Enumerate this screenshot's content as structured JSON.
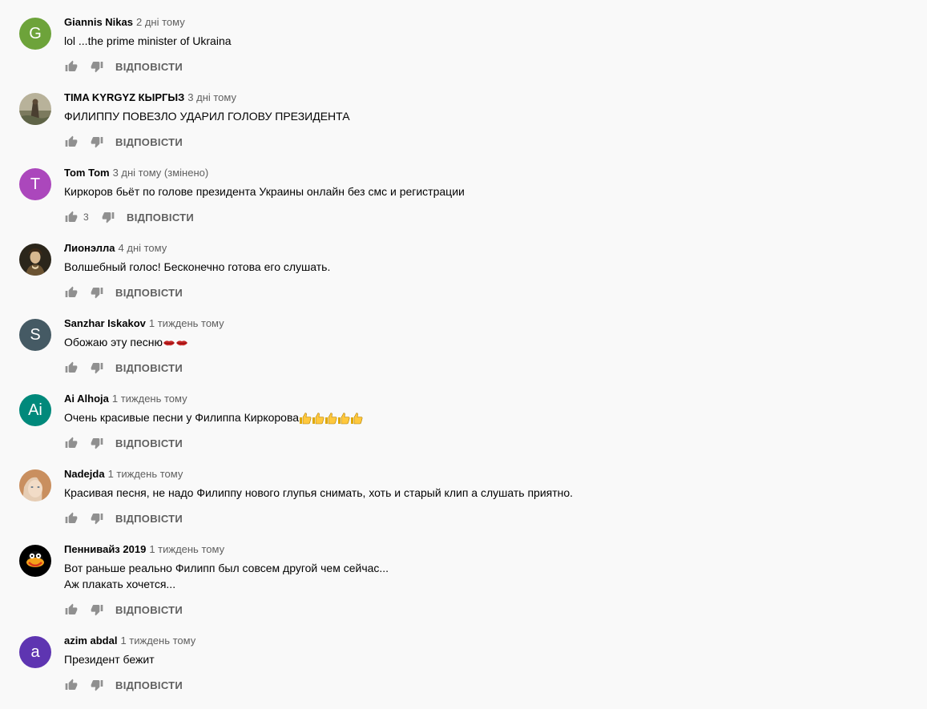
{
  "reply_label": "ВІДПОВІСТИ",
  "comments": [
    {
      "author": "Giannis Nikas",
      "time": "2 дні тому",
      "text": "lol ...the prime minister of Ukraina",
      "avatar": {
        "type": "letter",
        "letter": "G",
        "color": "#6da33a"
      },
      "likes": ""
    },
    {
      "author": "TIMA KYRGYZ КЫРГЫЗ",
      "time": "3 дні тому",
      "text": "ФИЛИППУ ПОВЕЗЛО УДАРИЛ ГОЛОВУ ПРЕЗИДЕНТА",
      "avatar": {
        "type": "photo",
        "color": "#8a8470"
      },
      "likes": ""
    },
    {
      "author": "Tom Tom",
      "time": "3 дні тому (змінено)",
      "text": "Киркоров бьёт по голове президента Украины онлайн без смс и регистрации",
      "avatar": {
        "type": "letter",
        "letter": "T",
        "color": "#ab47bc"
      },
      "likes": "3"
    },
    {
      "author": "Лионэлла",
      "time": "4 дні тому",
      "text": "Волшебный голос! Бесконечно готова его слушать.",
      "avatar": {
        "type": "photo",
        "color": "#2e2a1f"
      },
      "likes": ""
    },
    {
      "author": "Sanzhar Iskakov",
      "time": "1 тиждень тому",
      "text": "Обожаю эту песню",
      "emoji": "lips",
      "emoji_count": 2,
      "avatar": {
        "type": "letter",
        "letter": "S",
        "color": "#455a64"
      },
      "likes": ""
    },
    {
      "author": "Ai Alhoja",
      "time": "1 тиждень тому",
      "text": "Очень красивые песни у Филиппа Киркорова",
      "emoji": "thumbs",
      "emoji_count": 5,
      "avatar": {
        "type": "letter",
        "letter": "Ai",
        "color": "#00897b"
      },
      "likes": ""
    },
    {
      "author": "Nadejda",
      "time": "1 тиждень тому",
      "text": "Красивая песня, не надо Филиппу нового глупья снимать, хоть и старый клип а слушать приятно.",
      "avatar": {
        "type": "photo",
        "color": "#d9b79a"
      },
      "likes": ""
    },
    {
      "author": "Пеннивайз 2019",
      "time": "1 тиждень тому",
      "text": "Вот раньше реально Филипп был совсем другой чем сейчас...\nАж плакать хочется...",
      "avatar": {
        "type": "photo",
        "color": "#000000"
      },
      "likes": ""
    },
    {
      "author": "azim abdal",
      "time": "1 тиждень тому",
      "text": "Президент бежит",
      "avatar": {
        "type": "letter",
        "letter": "a",
        "color": "#5e35b1"
      },
      "likes": ""
    }
  ]
}
